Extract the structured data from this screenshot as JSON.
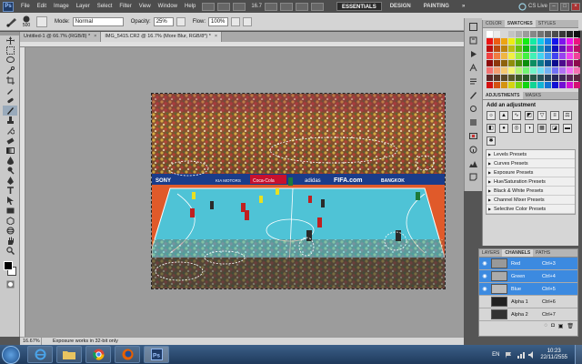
{
  "menubar": {
    "logo": "Ps",
    "items": [
      "File",
      "Edit",
      "Image",
      "Layer",
      "Select",
      "Filter",
      "View",
      "Window",
      "Help"
    ],
    "zoom": "16.7",
    "workspaces": [
      "ESSENTIALS",
      "DESIGN",
      "PAINTING"
    ],
    "more": "»",
    "cslive": "CS Live",
    "window_buttons": [
      "–",
      "□",
      "×"
    ]
  },
  "options": {
    "size": "500",
    "mode_label": "Mode:",
    "mode_value": "Normal",
    "opacity_label": "Opacity:",
    "opacity_value": "25%",
    "flow_label": "Flow:",
    "flow_value": "100%"
  },
  "tabs": [
    {
      "label": "Untitled-1 @ 66.7% (RGB/8) *",
      "close": "×"
    },
    {
      "label": "IMG_5415.CR2 @ 16.7% (More Blur, RGB/8*) *",
      "close": "×"
    }
  ],
  "status": {
    "zoom": "16.67%",
    "message": "Exposure works in 32-bit only"
  },
  "swatches_tabs": [
    "COLOR",
    "SWATCHES",
    "STYLES"
  ],
  "adjustments": {
    "tabs": [
      "ADJUSTMENTS",
      "MASKS"
    ],
    "title": "Add an adjustment",
    "presets": [
      "Levels Presets",
      "Curves Presets",
      "Exposure Presets",
      "Hue/Saturation Presets",
      "Black & White Presets",
      "Channel Mixer Presets",
      "Selective Color Presets"
    ]
  },
  "layers_panel": {
    "tabs": [
      "LAYERS",
      "CHANNELS",
      "PATHS"
    ],
    "channels": [
      {
        "name": "Red",
        "key": "Ctrl+3",
        "selected": true
      },
      {
        "name": "Green",
        "key": "Ctrl+4",
        "selected": true
      },
      {
        "name": "Blue",
        "key": "Ctrl+5",
        "selected": true
      },
      {
        "name": "Alpha 1",
        "key": "Ctrl+6",
        "selected": false
      },
      {
        "name": "Alpha 2",
        "key": "Ctrl+7",
        "selected": false
      }
    ]
  },
  "image": {
    "banner_texts": [
      "SONY",
      "KIA MOTORS",
      "Coca-Cola",
      "adidas",
      "FIFA.com",
      "BANGKOK"
    ]
  },
  "taskbar": {
    "lang": "EN",
    "time": "10:23",
    "date": "22/11/2555"
  },
  "colors": {
    "accent": "#3c8ae0",
    "court": "#4fc3d6",
    "court_border": "#e05a2a"
  }
}
